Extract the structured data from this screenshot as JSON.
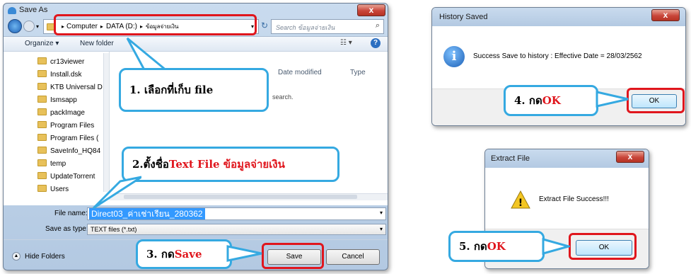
{
  "save_as": {
    "title": "Save As",
    "close_glyph": "x",
    "breadcrumb": [
      "Computer",
      "DATA (D:)",
      "ข้อมูลจ่ายเงิน"
    ],
    "search_placeholder": "Search ข้อมูลจ่ายเงิน",
    "organize_label": "Organize ▾",
    "new_folder_label": "New folder",
    "tree_items": [
      "cr13viewer",
      "Install.dsk",
      "KTB Universal D",
      "Ismsapp",
      "packImage",
      "Program Files",
      "Program Files (",
      "SaveInfo_HQ84",
      "temp",
      "UpdateTorrent",
      "Users"
    ],
    "col_date": "Date modified",
    "col_type": "Type",
    "empty_text": "search.",
    "file_name_label": "File name:",
    "file_name_value": "Direct03_ค่าเช่าเรียน_280362",
    "save_type_label": "Save as type:",
    "save_type_value": "TEXT files (*.txt)",
    "hide_folders_label": "Hide Folders",
    "save_label": "Save",
    "cancel_label": "Cancel"
  },
  "history_dialog": {
    "title": "History Saved",
    "message": "Success Save to history : Effective Date = 28/03/2562",
    "ok_label": "OK",
    "close_glyph": "x"
  },
  "extract_dialog": {
    "title": "Extract File",
    "message": "Extract File Success!!!",
    "ok_label": "OK",
    "close_glyph": "x"
  },
  "callouts": {
    "step1_text": "1. เลือกที่เก็บ file",
    "step2_prefix": "2.ตั้งชื่อ ",
    "step2_red": "Text File ข้อมูลจ่ายเงิน",
    "step3_prefix": "3. กด ",
    "step3_red": "Save",
    "step4_prefix": "4. กด ",
    "step4_red": "OK",
    "step5_prefix": "5. กด ",
    "step5_red": "OK"
  },
  "colors": {
    "callout_border": "#35a9e1",
    "highlight_red": "#e0161d"
  }
}
